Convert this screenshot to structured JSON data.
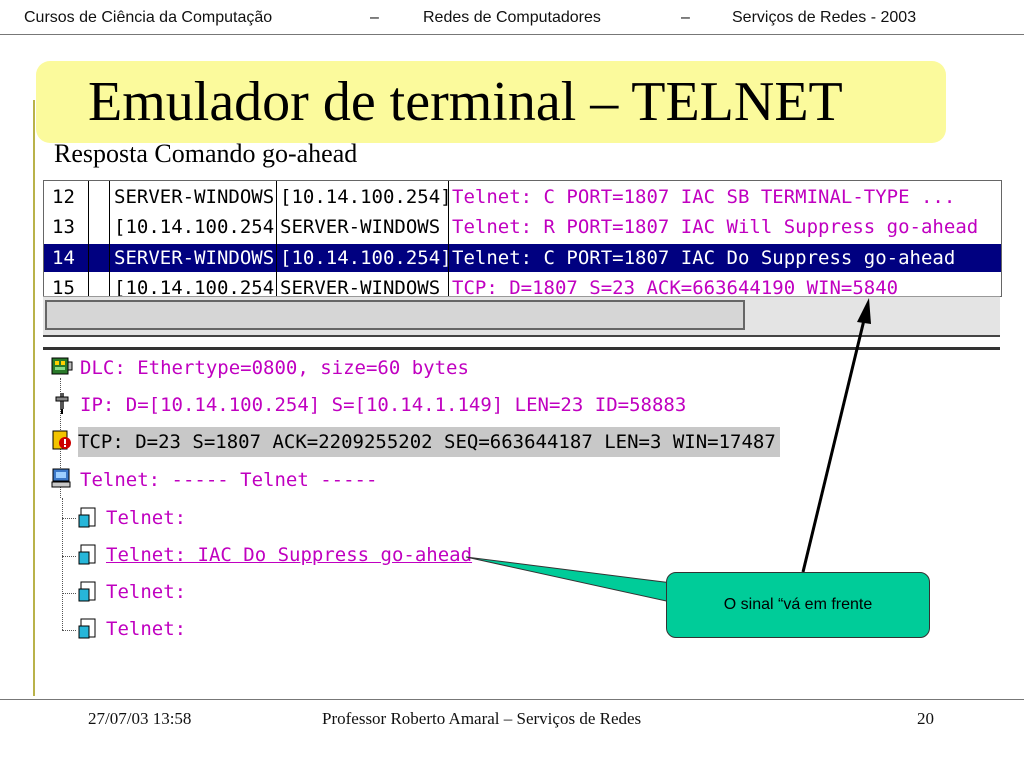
{
  "header": {
    "part1": "Cursos de Ciência da Computação",
    "sep1": "–",
    "part2": "Redes de Computadores",
    "sep2": "–",
    "part3": "Serviços de Redes -  2003"
  },
  "slide": {
    "title": "Emulador de terminal – TELNET",
    "subtitle": "Resposta Comando go-ahead"
  },
  "packet_list": {
    "rows": [
      {
        "num": "12",
        "src": "SERVER-WINDOWS",
        "dst": "[10.14.100.254]",
        "summary": "Telnet: C PORT=1807 IAC SB TERMINAL-TYPE ..."
      },
      {
        "num": "13",
        "src": "[10.14.100.254",
        "dst": "SERVER-WINDOWS",
        "summary": "Telnet: R PORT=1807 IAC Will Suppress go-ahead"
      },
      {
        "num": "14",
        "src": "SERVER-WINDOWS",
        "dst": "[10.14.100.254]",
        "summary": "Telnet: C PORT=1807 IAC Do Suppress go-ahead"
      },
      {
        "num": "15",
        "src": "[10.14.100.254",
        "dst": "SERVER-WINDOWS",
        "summary": "TCP: D=1807 S=23      ACK=663644190 WIN=5840"
      }
    ],
    "selected_index": 2
  },
  "detail_tree": {
    "dlc": "DLC: Ethertype=0800, size=60 bytes",
    "ip": "IP:  D=[10.14.100.254] S=[10.14.1.149] LEN=23 ID=58883",
    "tcp": "TCP: D=23 S=1807     ACK=2209255202 SEQ=663644187 LEN=3 WIN=17487",
    "telnet": "Telnet: ----- Telnet -----",
    "children": [
      "Telnet:",
      "Telnet: IAC Do Suppress go-ahead",
      "Telnet:",
      "Telnet:"
    ]
  },
  "callout": {
    "text": "O sinal “vá em frente"
  },
  "footer": {
    "date": "27/07/03 13:58",
    "center": "Professor Roberto Amaral – Serviços de Redes",
    "page": "20"
  },
  "colors": {
    "title_bg": "#fbfa9c",
    "selection": "#000080",
    "telnet_text": "#c000c0",
    "callout_bg": "#00cc99",
    "left_rule": "#b9b24a"
  },
  "icons": {
    "dlc": "network-card-icon",
    "ip": "ip-plug-icon",
    "tcp": "tcp-warning-icon",
    "telnet": "telnet-computer-icon",
    "child": "document-icon"
  }
}
